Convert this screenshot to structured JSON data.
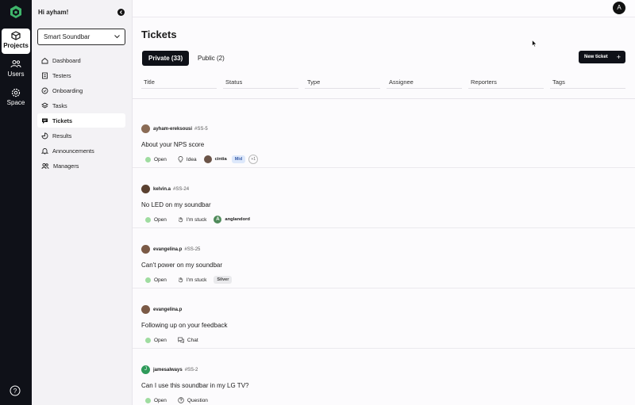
{
  "rail": {
    "items": [
      {
        "label": "Projects",
        "icon": "cube-icon"
      },
      {
        "label": "Users",
        "icon": "users-icon"
      },
      {
        "label": "Space",
        "icon": "gear-icon"
      }
    ]
  },
  "panel": {
    "greeting": "Hi ayham!",
    "project": "Smart Soundbar",
    "nav": [
      {
        "label": "Dashboard",
        "icon": "home-icon"
      },
      {
        "label": "Testers",
        "icon": "document-icon"
      },
      {
        "label": "Onboarding",
        "icon": "onboarding-icon"
      },
      {
        "label": "Tasks",
        "icon": "layers-icon"
      },
      {
        "label": "Tickets",
        "icon": "chat-icon"
      },
      {
        "label": "Results",
        "icon": "results-icon"
      },
      {
        "label": "Announcements",
        "icon": "bell-icon"
      },
      {
        "label": "Managers",
        "icon": "managers-icon"
      }
    ]
  },
  "topbar": {
    "avatar": "A"
  },
  "main": {
    "title": "Tickets",
    "tabs": [
      {
        "label": "Private (33)"
      },
      {
        "label": "Public (2)"
      }
    ],
    "new_ticket": "New ticket",
    "columns": [
      "Title",
      "Status",
      "Type",
      "Assignee",
      "Reporters",
      "Tags"
    ]
  },
  "tickets": [
    {
      "author": "ayham-ereksousi",
      "id": "#SS-5",
      "subject": "About your NPS score",
      "status": "Open",
      "type": "Idea",
      "assignee": "cintia",
      "badge": "Mid",
      "more": "+1"
    },
    {
      "author": "kelvin.a",
      "id": "#SS-24",
      "subject": "No LED on my soundbar",
      "status": "Open",
      "type": "I'm stuck",
      "assignee": "anglandord",
      "assignee_initial": "A"
    },
    {
      "author": "evangelina.p",
      "id": "#SS-25",
      "subject": "Can't power on my soundbar",
      "status": "Open",
      "type": "I'm stuck",
      "badge": "Silver"
    },
    {
      "author": "evangelina.p",
      "id": "",
      "subject": "Following up on your feedback",
      "status": "Open",
      "type": "Chat"
    },
    {
      "author": "jamesalways",
      "id": "#SS-2",
      "subject": "Can I use this soundbar in my LG TV?",
      "status": "Open",
      "type": "Question",
      "author_initial": "J"
    }
  ],
  "colors": {
    "dark": "#0f1118",
    "open": "#9fdca0",
    "brand": "#3fb56b"
  }
}
